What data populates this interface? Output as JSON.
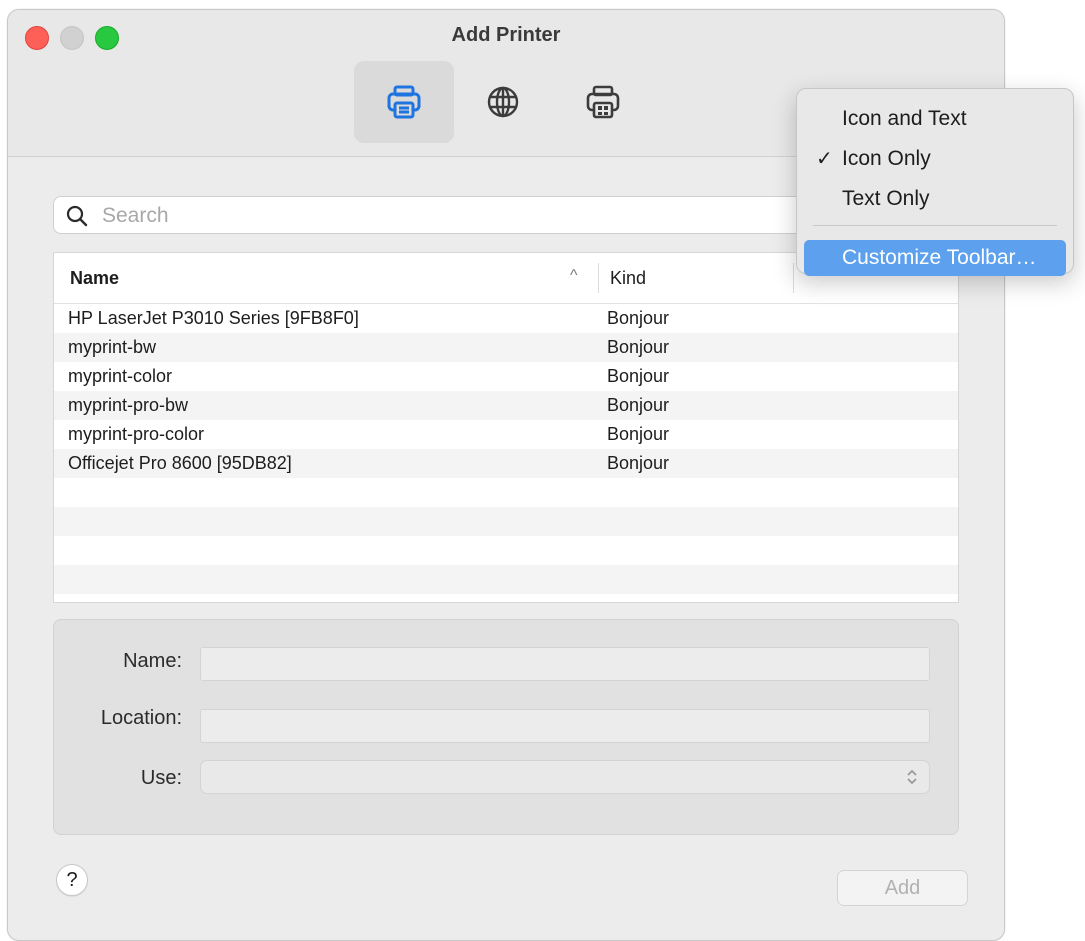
{
  "window": {
    "title": "Add Printer"
  },
  "toolbar": {
    "items": [
      {
        "icon": "default-printer-icon",
        "selected": true
      },
      {
        "icon": "ip-globe-icon",
        "selected": false
      },
      {
        "icon": "windows-printer-icon",
        "selected": false
      }
    ]
  },
  "search": {
    "placeholder": "Search",
    "value": ""
  },
  "table": {
    "columns": [
      "Name",
      "Kind"
    ],
    "sort_indicator": "^",
    "rows": [
      {
        "name": "HP LaserJet P3010 Series [9FB8F0]",
        "kind": "Bonjour"
      },
      {
        "name": "myprint-bw",
        "kind": "Bonjour"
      },
      {
        "name": "myprint-color",
        "kind": "Bonjour"
      },
      {
        "name": "myprint-pro-bw",
        "kind": "Bonjour"
      },
      {
        "name": "myprint-pro-color",
        "kind": "Bonjour"
      },
      {
        "name": "Officejet Pro 8600 [95DB82]",
        "kind": "Bonjour"
      }
    ]
  },
  "form": {
    "name_label": "Name:",
    "name_value": "",
    "location_label": "Location:",
    "location_value": "",
    "use_label": "Use:",
    "use_value": ""
  },
  "footer": {
    "help_label": "?",
    "add_label": "Add"
  },
  "context_menu": {
    "items": [
      {
        "label": "Icon and Text",
        "checked": false
      },
      {
        "label": "Icon Only",
        "checked": true,
        "check_mark": "✓"
      },
      {
        "label": "Text Only",
        "checked": false
      },
      {
        "label": "Customize Toolbar…",
        "highlighted": true
      }
    ],
    "highlight_color": "#5ca0ee"
  },
  "colors": {
    "accent": "#1e74e0",
    "close": "#fe5f57",
    "maximize": "#28c840"
  }
}
